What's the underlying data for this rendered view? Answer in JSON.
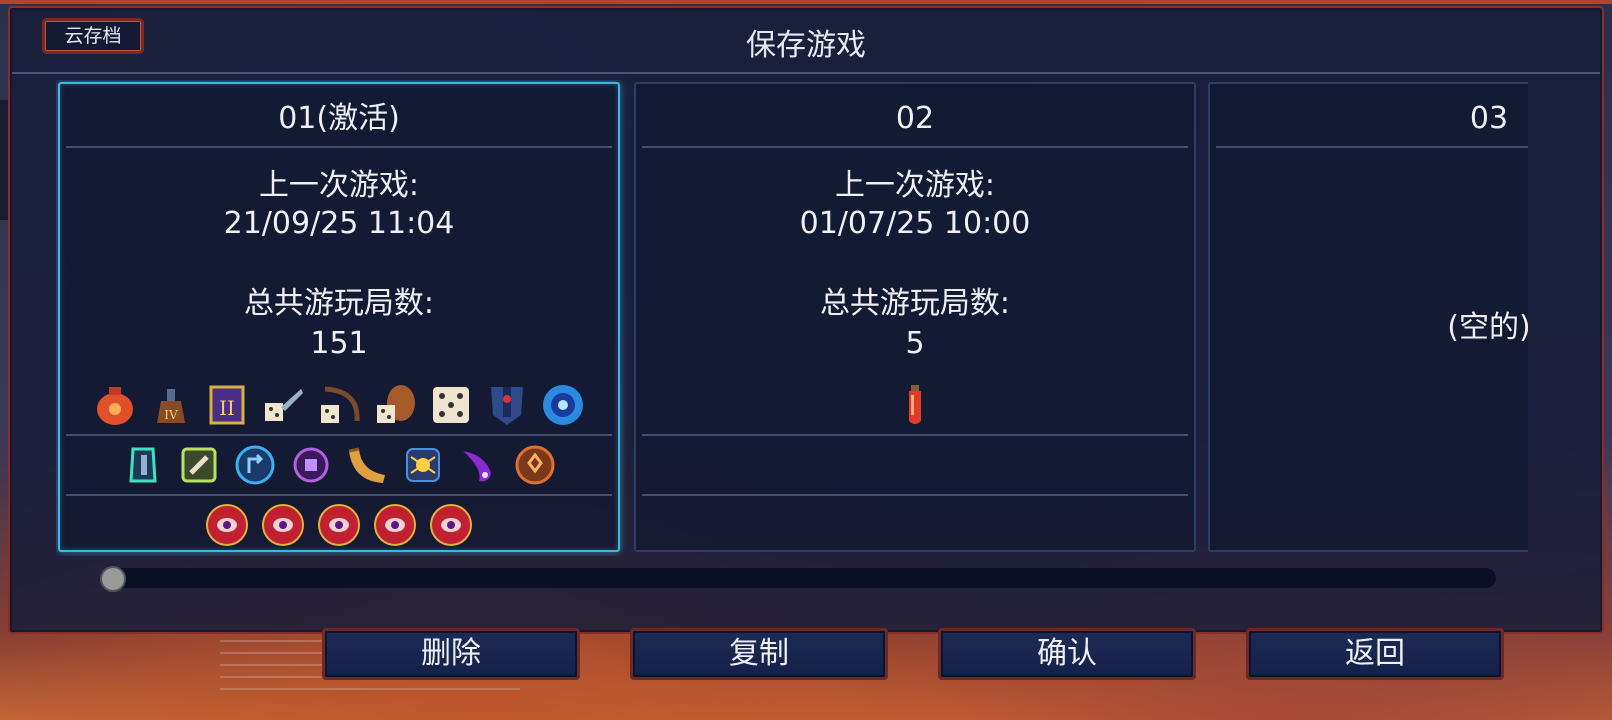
{
  "header": {
    "cloud_label": "云存档",
    "title": "保存游戏"
  },
  "slots": [
    {
      "name": "01(激活)",
      "active": true,
      "last_played_label": "上一次游戏:",
      "last_played": "21/09/25 11:04",
      "runs_label": "总共游玩局数:",
      "runs": "151",
      "row1_icons": [
        "red-potion-icon",
        "roman-four-flask-icon",
        "roman-two-card-icon",
        "dice-sword-icon",
        "dice-bow-icon",
        "dice-shield-icon",
        "white-dice-icon",
        "shield-icon",
        "blue-orb-icon"
      ],
      "row2_icons": [
        "rune-teal-icon",
        "rune-bone-icon",
        "rune-blue-arrow-icon",
        "rune-purple-icon",
        "horn-icon",
        "rune-spider-icon",
        "rune-purple-flame-icon",
        "rune-orange-icon"
      ],
      "row3_icons": [
        "red-eye-shield-icon",
        "red-eye-shield-icon",
        "red-eye-shield-icon",
        "red-eye-shield-icon",
        "red-eye-shield-icon"
      ]
    },
    {
      "name": "02",
      "active": false,
      "last_played_label": "上一次游戏:",
      "last_played": "01/07/25 10:00",
      "runs_label": "总共游玩局数:",
      "runs": "5",
      "row1_icons": [
        "red-flask-icon"
      ]
    },
    {
      "name": "03",
      "active": false,
      "empty_label": "(空的)"
    }
  ],
  "buttons": {
    "delete": "删除",
    "copy": "复制",
    "confirm": "确认",
    "back": "返回"
  },
  "slider": {
    "position": 0
  },
  "colors": {
    "active_border": "#3fb6e6",
    "frame_red": "#8a2e26",
    "panel_bg": "#181e3a"
  }
}
